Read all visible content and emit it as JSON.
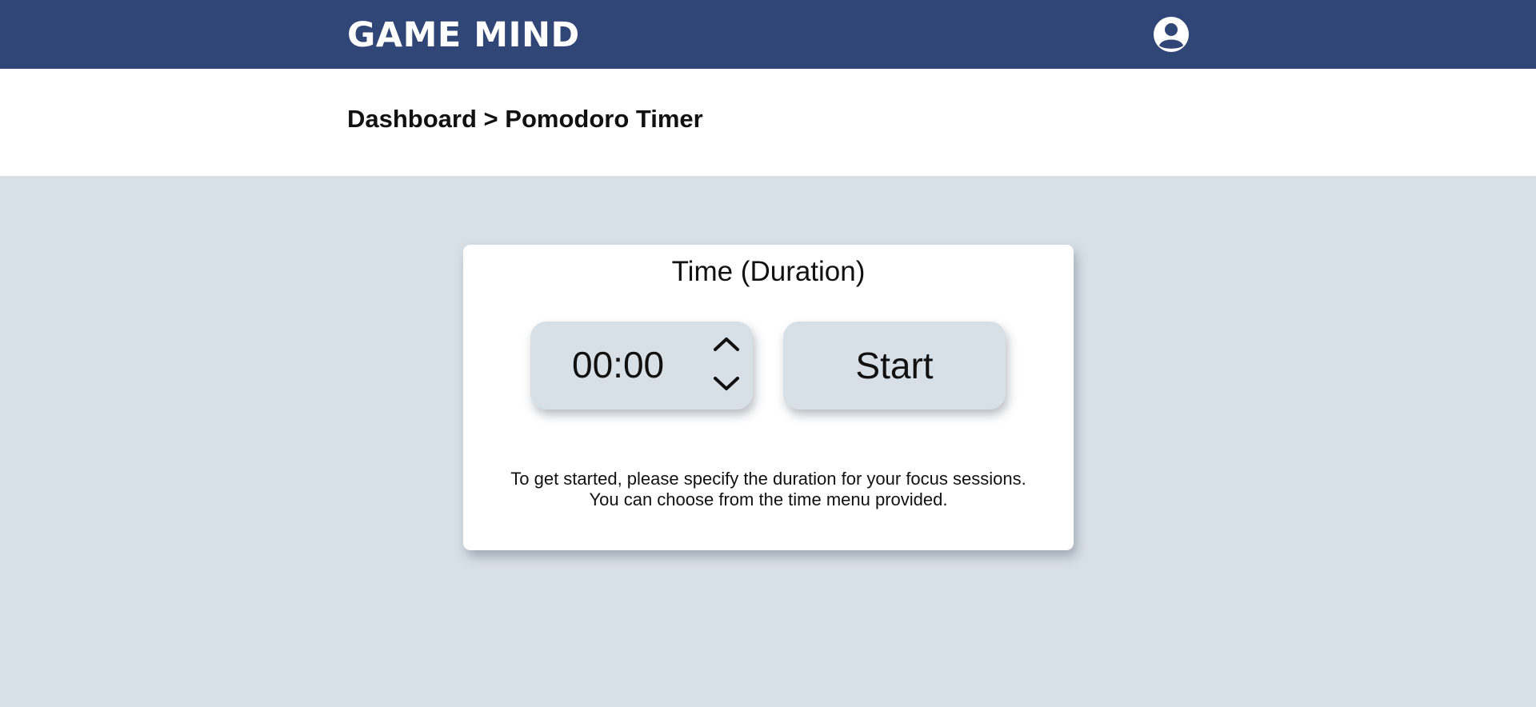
{
  "header": {
    "brand": "GAME MIND",
    "profile_icon": "user-circle-icon",
    "background_color": "#304676"
  },
  "breadcrumb": {
    "parent": "Dashboard",
    "separator": ">",
    "current": "Pomodoro Timer"
  },
  "timer_card": {
    "title": "Time (Duration)",
    "time_value": "00:00",
    "increase_icon": "chevron-up-icon",
    "decrease_icon": "chevron-down-icon",
    "start_label": "Start",
    "helper_line1": "To get started, please specify the duration for your focus sessions.",
    "helper_line2": "You can choose from the time menu provided."
  },
  "colors": {
    "page_background": "#d8e0e7",
    "card_background": "#ffffff",
    "control_background": "#d8e0e7"
  }
}
